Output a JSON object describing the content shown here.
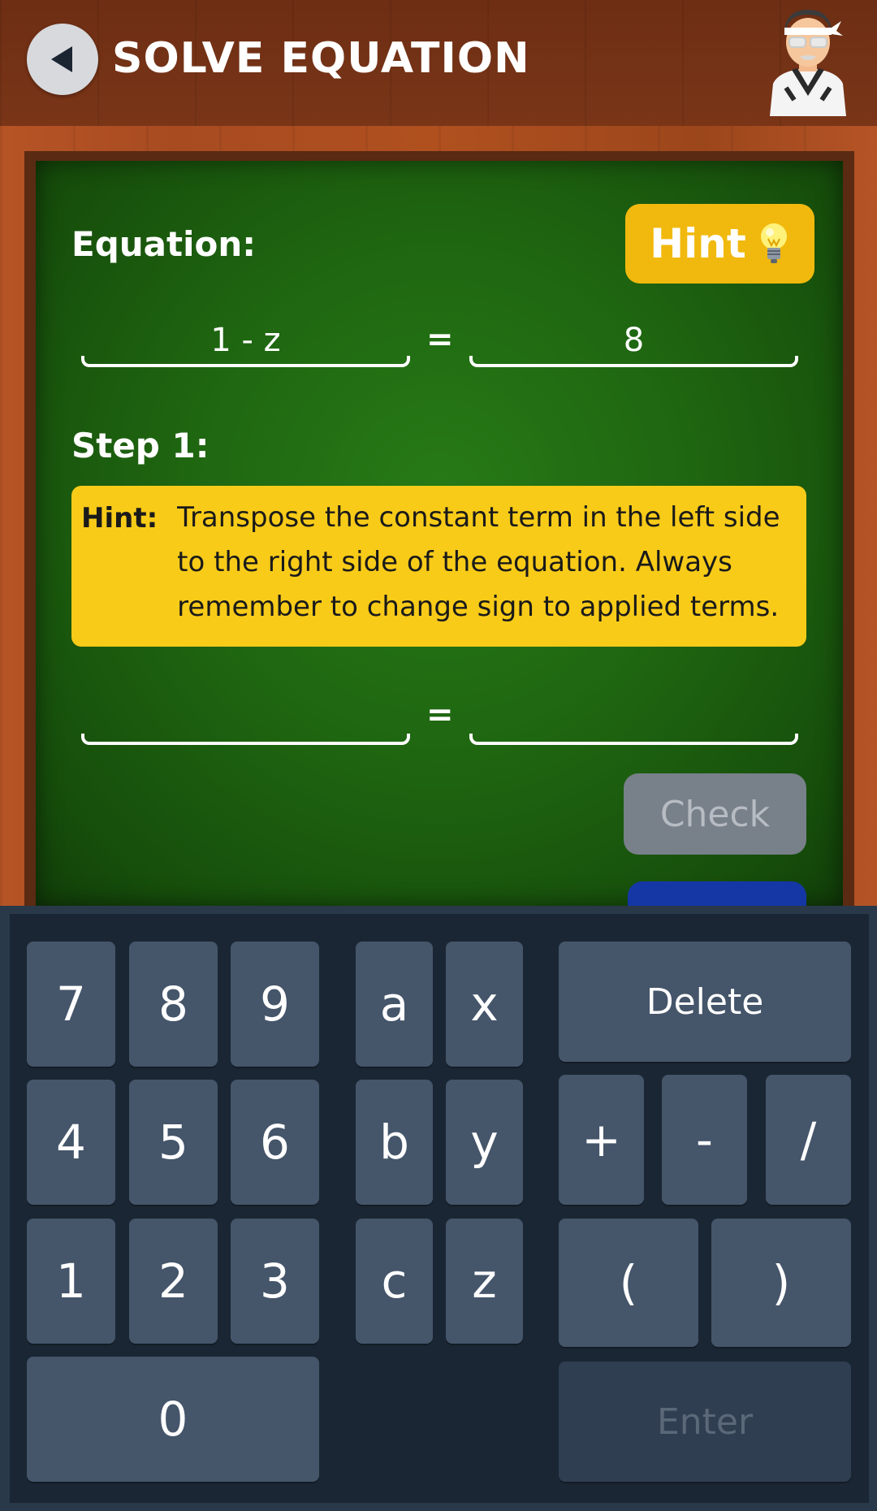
{
  "header": {
    "title": "SOLVE EQUATION",
    "back_icon": "back-arrow-icon",
    "avatar_icon": "teacher-avatar-icon"
  },
  "equation": {
    "label": "Equation:",
    "left": "1 - z",
    "sign": "=",
    "right": "8"
  },
  "hint_button": {
    "label": "Hint",
    "icon": "lightbulb-icon"
  },
  "step": {
    "label": "Step 1:",
    "hint_heading": "Hint:",
    "hint_text": "Transpose the constant term in the left side to the right side of the equation. Always remember to change sign to applied terms.",
    "left_value": "",
    "sign": "=",
    "right_value": ""
  },
  "check_button": {
    "label": "Check"
  },
  "keypad": {
    "k7": "7",
    "k8": "8",
    "k9": "9",
    "k4": "4",
    "k5": "5",
    "k6": "6",
    "k1": "1",
    "k2": "2",
    "k3": "3",
    "k0": "0",
    "ka": "a",
    "kx": "x",
    "kb": "b",
    "ky": "y",
    "kc": "c",
    "kz": "z",
    "delete": "Delete",
    "plus": "+",
    "minus": "-",
    "slash": "/",
    "lparen": "(",
    "rparen": ")",
    "enter": "Enter"
  },
  "colors": {
    "header": "#6d2e14",
    "board": "#1f6611",
    "hint_yellow": "#f8cb19",
    "hint_button": "#f1b90d",
    "check_disabled": "#78808a",
    "key": "#45556a",
    "keypad_bg": "#1a2633"
  }
}
